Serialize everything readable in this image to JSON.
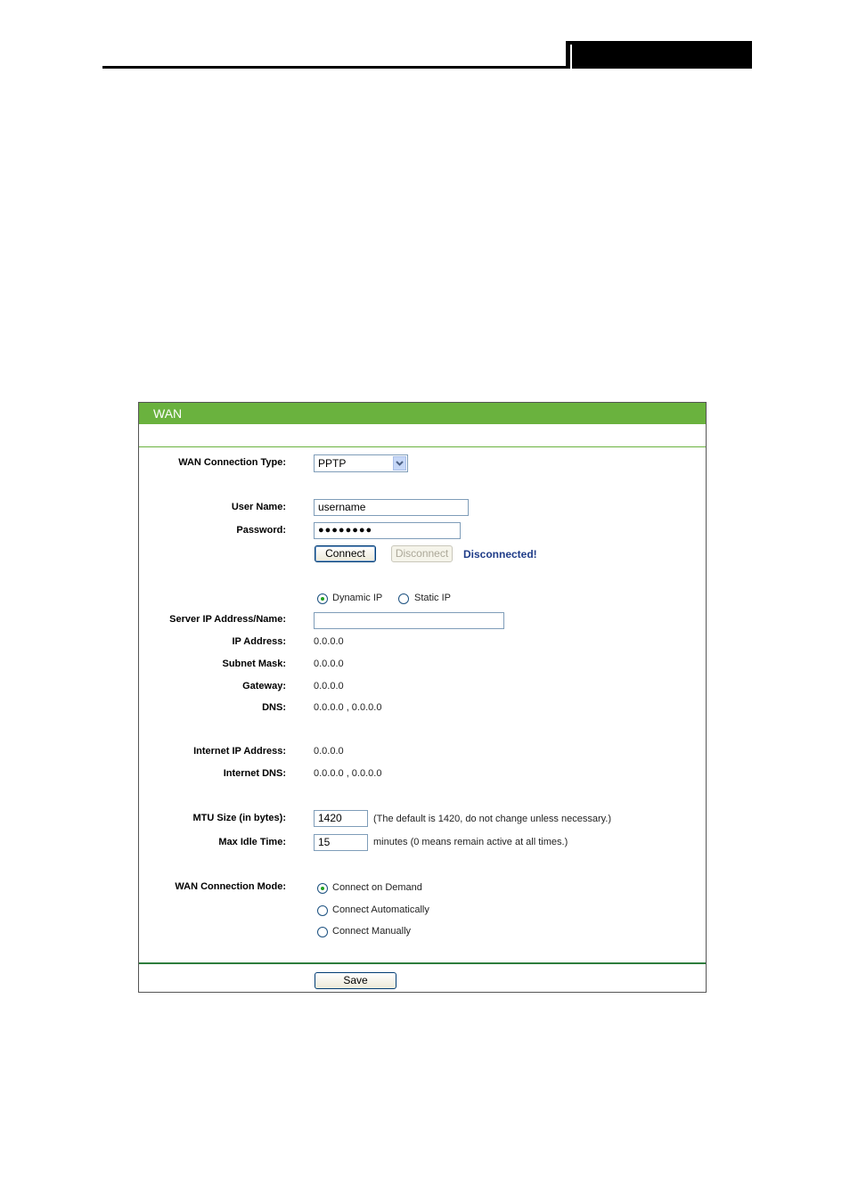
{
  "panel": {
    "title": "WAN"
  },
  "form": {
    "wan_type_label": "WAN Connection Type:",
    "wan_type_value": "PPTP",
    "user_name_label": "User Name:",
    "user_name_value": "username",
    "password_label": "Password:",
    "password_value": "●●●●●●●●",
    "connect_button": "Connect",
    "disconnect_button": "Disconnect",
    "status": "Disconnected!",
    "ip_mode_options": [
      "Dynamic IP",
      "Static IP"
    ],
    "ip_mode_selected": "Dynamic IP",
    "server_label": "Server IP Address/Name:",
    "server_value": "",
    "ip_label": "IP Address:",
    "ip_value": "0.0.0.0",
    "subnet_label": "Subnet Mask:",
    "subnet_value": "0.0.0.0",
    "gateway_label": "Gateway:",
    "gateway_value": "0.0.0.0",
    "dns_label": "DNS:",
    "dns_value": "0.0.0.0 , 0.0.0.0",
    "internet_ip_label": "Internet IP Address:",
    "internet_ip_value": "0.0.0.0",
    "internet_dns_label": "Internet DNS:",
    "internet_dns_value": "0.0.0.0 , 0.0.0.0",
    "mtu_label": "MTU Size (in bytes):",
    "mtu_value": "1420",
    "mtu_hint": "(The default is 1420, do not change unless necessary.)",
    "idle_label": "Max Idle Time:",
    "idle_value": "15",
    "idle_hint": "minutes (0 means remain active at all times.)",
    "mode_label": "WAN Connection Mode:",
    "mode_options": [
      "Connect on Demand",
      "Connect Automatically",
      "Connect Manually"
    ],
    "mode_selected": "Connect on Demand",
    "save_button": "Save"
  }
}
